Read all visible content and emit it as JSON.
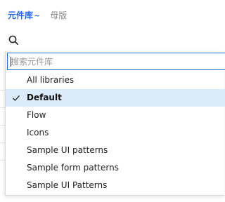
{
  "tabs": {
    "active_label": "元件库",
    "active_chevron": "~",
    "inactive_label": "母版"
  },
  "search": {
    "icon": "search-icon",
    "placeholder": "搜索元件库",
    "value": ""
  },
  "dropdown": {
    "items": [
      {
        "label": "All libraries",
        "selected": false
      },
      {
        "label": "Default",
        "selected": true
      },
      {
        "label": "Flow",
        "selected": false
      },
      {
        "label": "Icons",
        "selected": false
      },
      {
        "label": "Sample UI patterns",
        "selected": false
      },
      {
        "label": "Sample form patterns",
        "selected": false
      },
      {
        "label": "Sample UI Patterns",
        "selected": false
      }
    ]
  },
  "colors": {
    "accent": "#2563eb",
    "selected_bg": "#dcebfa",
    "input_border": "#1e6fe6",
    "inactive_tab": "#8a8a8a"
  }
}
